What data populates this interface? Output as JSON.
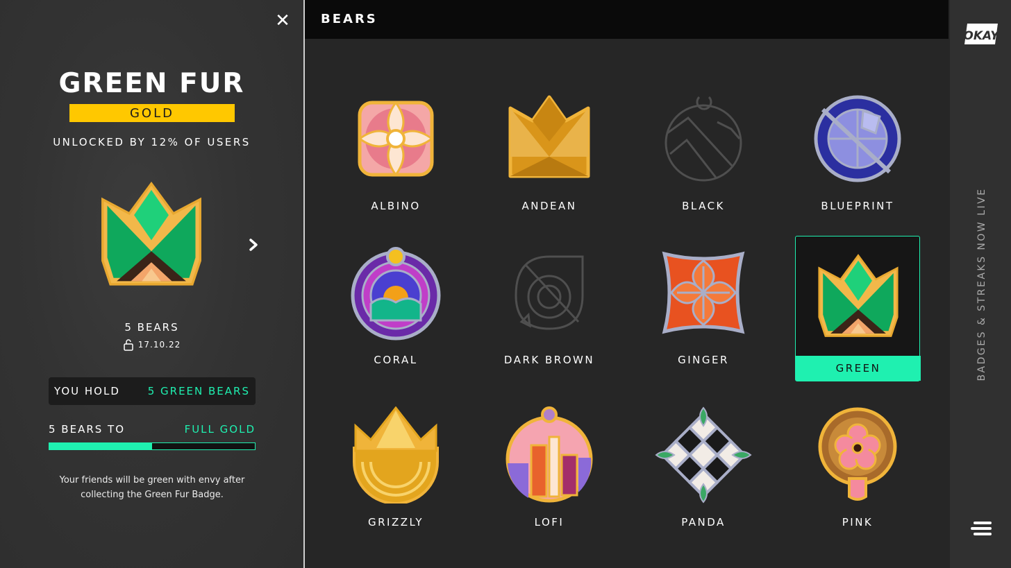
{
  "detail": {
    "title": "GREEN FUR",
    "tier": "GOLD",
    "unlocked": "UNLOCKED BY 12% OF USERS",
    "count": "5 BEARS",
    "date": "17.10.22",
    "hold_label": "YOU HOLD",
    "hold_value": "5 GREEN BEARS",
    "progress_label": "5 BEARS TO",
    "progress_target": "FULL GOLD",
    "progress_fraction": 0.5,
    "description": "Your friends will be green with envy after collecting the Green Fur Badge."
  },
  "header": {
    "title": "BEARS"
  },
  "badges": [
    {
      "label": "ALBINO"
    },
    {
      "label": "ANDEAN"
    },
    {
      "label": "BLACK"
    },
    {
      "label": "BLUEPRINT"
    },
    {
      "label": "CORAL"
    },
    {
      "label": "DARK BROWN"
    },
    {
      "label": "GINGER"
    },
    {
      "label": "GREEN"
    },
    {
      "label": "GRIZZLY"
    },
    {
      "label": "LOFI"
    },
    {
      "label": "PANDA"
    },
    {
      "label": "PINK"
    }
  ],
  "selected_badge": "GREEN",
  "rail": {
    "logo": "OKAY",
    "vertical_text": "BADGES & STREAKS NOW LIVE"
  },
  "icons": {
    "close": "close-icon",
    "next": "chevron-right-icon",
    "lock": "lock-icon",
    "menu": "menu-icon"
  },
  "colors": {
    "accent": "#1ff0b0",
    "gold": "#ffc800"
  }
}
